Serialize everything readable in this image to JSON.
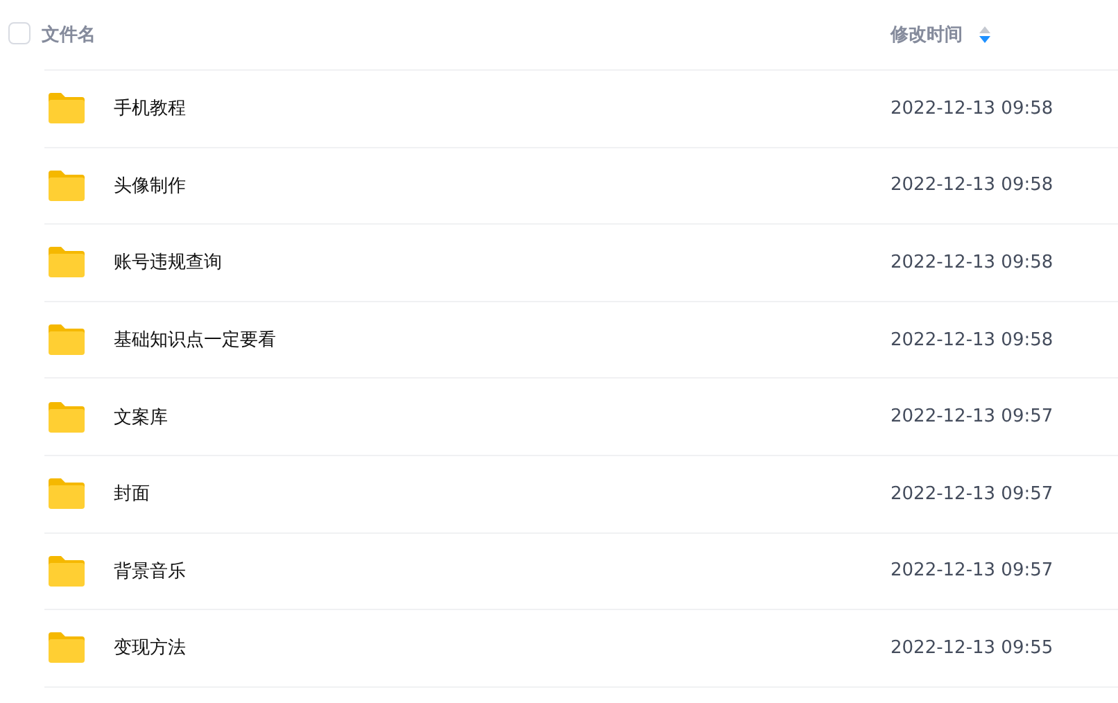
{
  "header": {
    "select_all": {
      "checked": false
    },
    "name_column": "文件名",
    "time_column": "修改时间",
    "sort_descending": true
  },
  "rows": [
    {
      "name": "手机教程",
      "modified": "2022-12-13 09:58",
      "selected": false
    },
    {
      "name": "头像制作",
      "modified": "2022-12-13 09:58",
      "selected": false
    },
    {
      "name": "账号违规查询",
      "modified": "2022-12-13 09:58",
      "selected": false
    },
    {
      "name": "基础知识点一定要看",
      "modified": "2022-12-13 09:58",
      "selected": false
    },
    {
      "name": "文案库",
      "modified": "2022-12-13 09:57",
      "selected": false
    },
    {
      "name": "封面",
      "modified": "2022-12-13 09:57",
      "selected": false
    },
    {
      "name": "背景音乐",
      "modified": "2022-12-13 09:57",
      "selected": false
    },
    {
      "name": "变现方法",
      "modified": "2022-12-13 09:55",
      "selected": false
    }
  ]
}
